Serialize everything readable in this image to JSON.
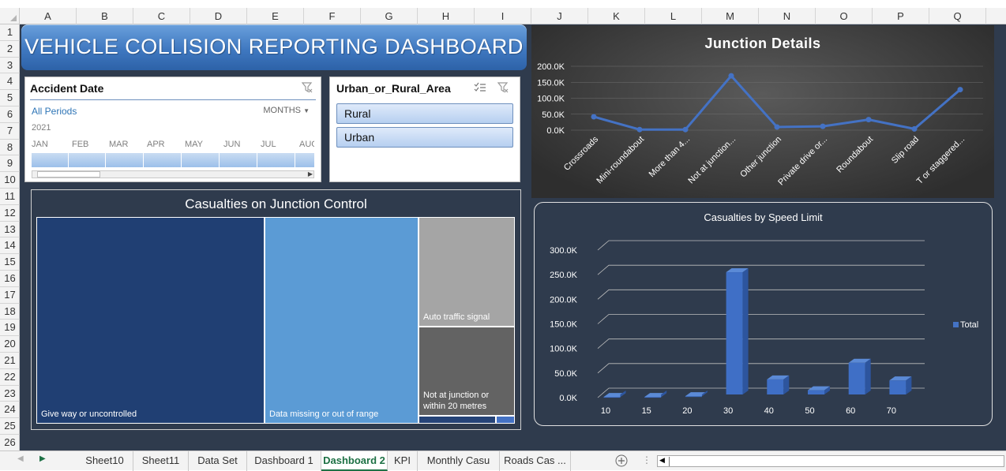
{
  "columns": [
    "A",
    "B",
    "C",
    "D",
    "E",
    "F",
    "G",
    "H",
    "I",
    "J",
    "K",
    "L",
    "M",
    "N",
    "O",
    "P",
    "Q"
  ],
  "rows": [
    "1",
    "2",
    "3",
    "4",
    "5",
    "6",
    "7",
    "8",
    "9",
    "10",
    "11",
    "12",
    "13",
    "14",
    "15",
    "16",
    "17",
    "18",
    "19",
    "20",
    "21",
    "22",
    "23",
    "24",
    "25",
    "26"
  ],
  "dashboard": {
    "title": "VEHICLE COLLISION REPORTING DASHBOARD"
  },
  "timeline": {
    "title": "Accident Date",
    "all_periods": "All Periods",
    "level": "MONTHS",
    "year": "2021",
    "months": [
      "JAN",
      "FEB",
      "MAR",
      "APR",
      "MAY",
      "JUN",
      "JUL",
      "AUG"
    ]
  },
  "slicer": {
    "title": "Urban_or_Rural_Area",
    "items": [
      "Rural",
      "Urban"
    ]
  },
  "treemap": {
    "title": "Casualties on Junction Control",
    "tiles": [
      {
        "label": "Give way or uncontrolled",
        "color": "#203f73"
      },
      {
        "label": "Data missing or out of range",
        "color": "#5b9bd5"
      },
      {
        "label": "Auto traffic signal",
        "color": "#a5a5a5"
      },
      {
        "label": "Not at junction or within 20 metres",
        "color": "#636363"
      },
      {
        "label": "",
        "color": "#264478"
      },
      {
        "label": "",
        "color": "#4472c4"
      }
    ]
  },
  "chart_data": [
    {
      "type": "line",
      "title": "Junction Details",
      "categories": [
        "Crossroads",
        "Mini-roundabout",
        "More than 4...",
        "Not at junction...",
        "Other junction",
        "Private drive or...",
        "Roundabout",
        "Slip road",
        "T or staggered..."
      ],
      "values": [
        42000,
        2000,
        2000,
        170000,
        10000,
        12000,
        33000,
        4000,
        127000
      ],
      "y_ticks": [
        "0.0K",
        "50.0K",
        "100.0K",
        "150.0K",
        "200.0K"
      ],
      "ylim": [
        0,
        200000
      ],
      "grid": true,
      "color": "#4472c4"
    },
    {
      "type": "bar",
      "title": "Casualties by Speed Limit",
      "categories": [
        "10",
        "15",
        "20",
        "30",
        "40",
        "50",
        "60",
        "70"
      ],
      "series": [
        {
          "name": "Total",
          "values": [
            1500,
            1500,
            3000,
            255000,
            37000,
            15000,
            71000,
            35000
          ]
        }
      ],
      "y_ticks": [
        "0.0K",
        "50.0K",
        "100.0K",
        "150.0K",
        "200.0K",
        "250.0K",
        "300.0K"
      ],
      "ylim": [
        0,
        300000
      ],
      "grid": true,
      "legend": "right",
      "color": "#4472c4"
    }
  ],
  "tabs": [
    "Sheet10",
    "Sheet11",
    "Data Set",
    "Dashboard 1",
    "Dashboard 2",
    "KPI",
    "Monthly Casu",
    "Roads Cas ..."
  ],
  "active_tab": "Dashboard 2"
}
